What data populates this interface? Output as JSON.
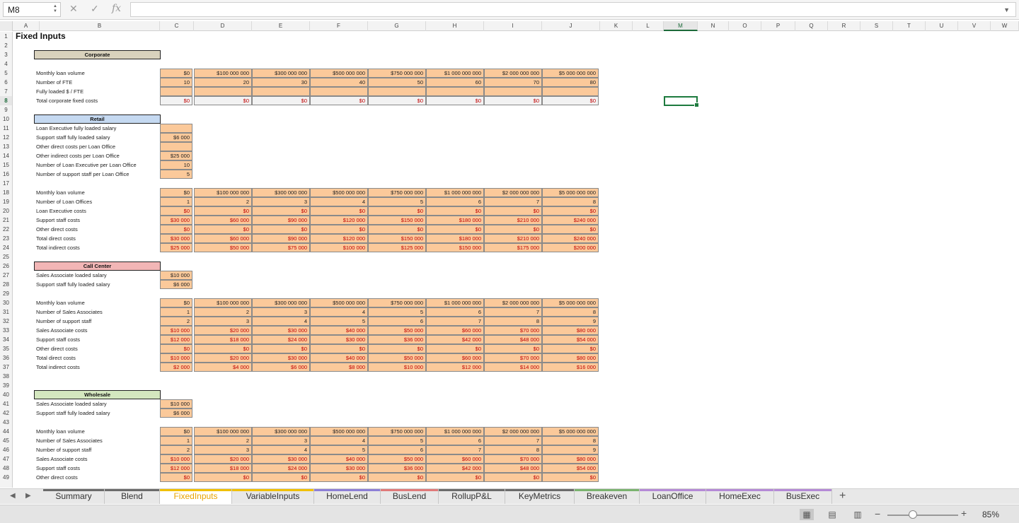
{
  "formula_bar": {
    "name_box": "M8",
    "formula": ""
  },
  "columns": [
    "A",
    "B",
    "C",
    "D",
    "E",
    "F",
    "G",
    "H",
    "I",
    "J",
    "K",
    "L",
    "M",
    "N",
    "O",
    "P",
    "Q",
    "R",
    "S",
    "T",
    "U",
    "V",
    "W"
  ],
  "selected_column": "M",
  "selected_row": "8",
  "rows": [
    "1",
    "2",
    "3",
    "4",
    "5",
    "6",
    "7",
    "8",
    "9",
    "10",
    "11",
    "12",
    "13",
    "14",
    "15",
    "16",
    "17",
    "18",
    "19",
    "20",
    "21",
    "22",
    "23",
    "24",
    "25",
    "26",
    "27",
    "28",
    "29",
    "30",
    "31",
    "32",
    "33",
    "34",
    "35",
    "36",
    "37",
    "38",
    "39",
    "40",
    "41",
    "42",
    "43",
    "44",
    "45",
    "46",
    "47",
    "48",
    "49"
  ],
  "title": "Fixed Inputs",
  "sections": {
    "corporate": {
      "header": "Corporate",
      "header_color": "#d9d2bd",
      "labels": [
        "Monthly loan volume",
        "Number of FTE",
        "Fully loaded $ / FTE",
        "Total corporate fixed costs"
      ],
      "rows": [
        [
          "$0",
          "$100 000 000",
          "$300 000 000",
          "$500 000 000",
          "$750 000 000",
          "$1 000 000 000",
          "$2 000 000 000",
          "$5 000 000 000"
        ],
        [
          "10",
          "20",
          "30",
          "40",
          "50",
          "60",
          "70",
          "80"
        ],
        [
          "",
          "",
          "",
          "",
          "",
          "",
          "",
          ""
        ],
        [
          "$0",
          "$0",
          "$0",
          "$0",
          "$0",
          "$0",
          "$0",
          "$0"
        ]
      ]
    },
    "retail": {
      "header": "Retail",
      "header_color": "#c5d9f1",
      "input_labels": [
        "Loan Executive fully loaded salary",
        "Support staff fully loaded salary",
        "Other direct costs per Loan Office",
        "Other indirect costs per Loan Office",
        "Number of Loan Executive per Loan Office",
        "Number of support staff per Loan Office"
      ],
      "input_values": [
        "",
        "$6 000",
        "",
        "$25 000",
        "10",
        "5"
      ],
      "labels": [
        "Monthly loan volume",
        "Number of Loan Offices",
        "Loan Executive costs",
        "Support staff costs",
        "Other direct costs",
        "Total direct costs",
        "Total indirect costs"
      ],
      "rows": [
        [
          "$0",
          "$100 000 000",
          "$300 000 000",
          "$500 000 000",
          "$750 000 000",
          "$1 000 000 000",
          "$2 000 000 000",
          "$5 000 000 000"
        ],
        [
          "1",
          "2",
          "3",
          "4",
          "5",
          "6",
          "7",
          "8"
        ],
        [
          "$0",
          "$0",
          "$0",
          "$0",
          "$0",
          "$0",
          "$0",
          "$0"
        ],
        [
          "$30 000",
          "$60 000",
          "$90 000",
          "$120 000",
          "$150 000",
          "$180 000",
          "$210 000",
          "$240 000"
        ],
        [
          "$0",
          "$0",
          "$0",
          "$0",
          "$0",
          "$0",
          "$0",
          "$0"
        ],
        [
          "$30 000",
          "$60 000",
          "$90 000",
          "$120 000",
          "$150 000",
          "$180 000",
          "$210 000",
          "$240 000"
        ],
        [
          "$25 000",
          "$50 000",
          "$75 000",
          "$100 000",
          "$125 000",
          "$150 000",
          "$175 000",
          "$200 000"
        ]
      ]
    },
    "call_center": {
      "header": "Call Center",
      "header_color": "#f2b6b6",
      "input_labels": [
        "Sales Associate loaded salary",
        "Support staff fully loaded salary"
      ],
      "input_values": [
        "$10 000",
        "$6 000"
      ],
      "labels": [
        "Monthly loan volume",
        "Number of Sales Associates",
        "Number of support staff",
        "Sales Associate costs",
        "Support staff costs",
        "Other direct costs",
        "Total direct costs",
        "Total indirect costs"
      ],
      "rows": [
        [
          "$0",
          "$100 000 000",
          "$300 000 000",
          "$500 000 000",
          "$750 000 000",
          "$1 000 000 000",
          "$2 000 000 000",
          "$5 000 000 000"
        ],
        [
          "1",
          "2",
          "3",
          "4",
          "5",
          "6",
          "7",
          "8"
        ],
        [
          "2",
          "3",
          "4",
          "5",
          "6",
          "7",
          "8",
          "9"
        ],
        [
          "$10 000",
          "$20 000",
          "$30 000",
          "$40 000",
          "$50 000",
          "$60 000",
          "$70 000",
          "$80 000"
        ],
        [
          "$12 000",
          "$18 000",
          "$24 000",
          "$30 000",
          "$36 000",
          "$42 000",
          "$48 000",
          "$54 000"
        ],
        [
          "$0",
          "$0",
          "$0",
          "$0",
          "$0",
          "$0",
          "$0",
          "$0"
        ],
        [
          "$10 000",
          "$20 000",
          "$30 000",
          "$40 000",
          "$50 000",
          "$60 000",
          "$70 000",
          "$80 000"
        ],
        [
          "$2 000",
          "$4 000",
          "$6 000",
          "$8 000",
          "$10 000",
          "$12 000",
          "$14 000",
          "$16 000"
        ]
      ]
    },
    "wholesale": {
      "header": "Wholesale",
      "header_color": "#d4e7bf",
      "input_labels": [
        "Sales Associate loaded salary",
        "Support staff fully loaded salary"
      ],
      "input_values": [
        "$10 000",
        "$6 000"
      ],
      "labels": [
        "Monthly loan volume",
        "Number of Sales Associates",
        "Number of support staff",
        "Sales Associate costs",
        "Support staff costs",
        "Other direct costs"
      ],
      "rows": [
        [
          "$0",
          "$100 000 000",
          "$300 000 000",
          "$500 000 000",
          "$750 000 000",
          "$1 000 000 000",
          "$2 000 000 000",
          "$5 000 000 000"
        ],
        [
          "1",
          "2",
          "3",
          "4",
          "5",
          "6",
          "7",
          "8"
        ],
        [
          "2",
          "3",
          "4",
          "5",
          "6",
          "7",
          "8",
          "9"
        ],
        [
          "$10 000",
          "$20 000",
          "$30 000",
          "$40 000",
          "$50 000",
          "$60 000",
          "$70 000",
          "$80 000"
        ],
        [
          "$12 000",
          "$18 000",
          "$24 000",
          "$30 000",
          "$36 000",
          "$42 000",
          "$48 000",
          "$54 000"
        ],
        [
          "$0",
          "$0",
          "$0",
          "$0",
          "$0",
          "$0",
          "$0",
          "$0"
        ]
      ]
    }
  },
  "tabs": [
    {
      "label": "Summary",
      "color": "#6b6b6b"
    },
    {
      "label": "Blend",
      "color": "#6b6b6b"
    },
    {
      "label": "FixedInputs",
      "color": "#f0c000",
      "active": true
    },
    {
      "label": "VariableInputs",
      "color": "#f0c000"
    },
    {
      "label": "HomeLend",
      "color": "#8d7fd6"
    },
    {
      "label": "BusLend",
      "color": "#e07a7a"
    },
    {
      "label": "RollupP&L",
      "color": "#6b6b6b"
    },
    {
      "label": "KeyMetrics",
      "color": "#6b6b6b"
    },
    {
      "label": "Breakeven",
      "color": "#7bb36f"
    },
    {
      "label": "LoanOffice",
      "color": "#b58ad6"
    },
    {
      "label": "HomeExec",
      "color": "#b58ad6"
    },
    {
      "label": "BusExec",
      "color": "#b58ad6"
    }
  ],
  "status": {
    "zoom": "85%",
    "zoom_fraction": 0.5
  }
}
